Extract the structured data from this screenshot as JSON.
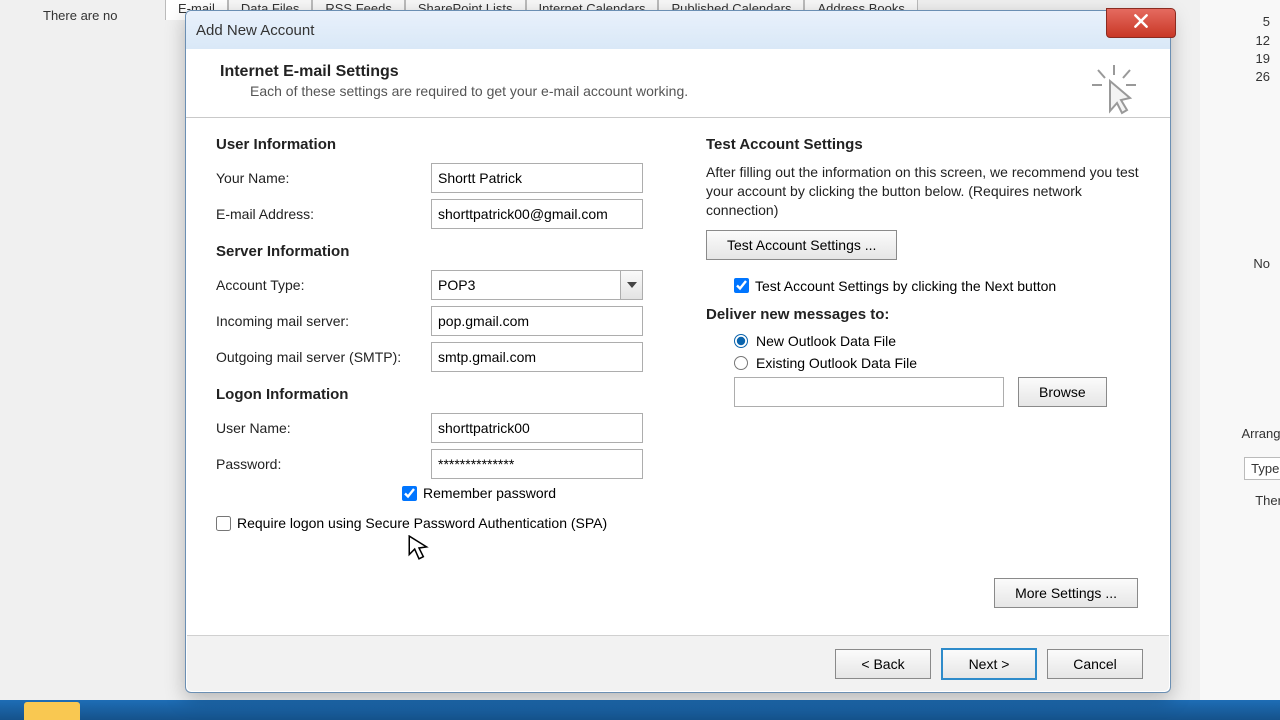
{
  "bg": {
    "text_left": "There are no",
    "tabs": [
      "E-mail",
      "Data Files",
      "RSS Feeds",
      "SharePoint Lists",
      "Internet Calendars",
      "Published Calendars",
      "Address Books"
    ],
    "right_nums": [
      "5",
      "12",
      "19",
      "26"
    ],
    "right_no": "No",
    "right_arrange": "Arrange E",
    "right_type": "Type a n",
    "right_there": "There a"
  },
  "dialog_title": "Add New Account",
  "header": {
    "title": "Internet E-mail Settings",
    "subtitle": "Each of these settings are required to get your e-mail account working."
  },
  "left": {
    "user_info_h": "User Information",
    "name_l": "Your Name:",
    "name_v": "Shortt Patrick",
    "email_l": "E-mail Address:",
    "email_v": "shorttpatrick00@gmail.com",
    "server_info_h": "Server Information",
    "acct_type_l": "Account Type:",
    "acct_type_v": "POP3",
    "incoming_l": "Incoming mail server:",
    "incoming_v": "pop.gmail.com",
    "outgoing_l": "Outgoing mail server (SMTP):",
    "outgoing_v": "smtp.gmail.com",
    "logon_h": "Logon Information",
    "user_l": "User Name:",
    "user_v": "shorttpatrick00",
    "pass_l": "Password:",
    "pass_v": "**************",
    "remember_l": "Remember password",
    "spa_l": "Require logon using Secure Password Authentication (SPA)"
  },
  "right": {
    "test_h": "Test Account Settings",
    "test_p": "After filling out the information on this screen, we recommend you test your account by clicking the button below. (Requires network connection)",
    "test_btn": "Test Account Settings ...",
    "test_chk": "Test Account Settings by clicking the Next button",
    "deliver_h": "Deliver new messages to:",
    "radio_new": "New Outlook Data File",
    "radio_existing": "Existing Outlook Data File",
    "browse_btn": "Browse",
    "more_btn": "More Settings ..."
  },
  "footer": {
    "back": "< Back",
    "next": "Next >",
    "cancel": "Cancel"
  }
}
